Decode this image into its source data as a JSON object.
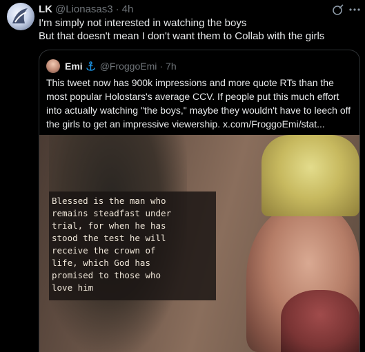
{
  "tweet": {
    "author_name": "LK",
    "handle": "@Lionasas3",
    "separator": "·",
    "time": "4h",
    "lines": [
      "I'm simply not interested in watching the boys",
      "But that doesn't mean I don't want them to Collab with the girls"
    ]
  },
  "quote": {
    "author_name": "Emi",
    "handle": "@FroggoEmi",
    "separator": "·",
    "time": "7h",
    "lines": [
      "This tweet now has 900k impressions and  more quote RTs than the",
      "most popular Holostars's average CCV. If people put this much effort",
      "into actually watching \"the boys,\" maybe they wouldn't have to leech off",
      "the girls to get an impressive viewership.  x.com/FroggoEmi/stat..."
    ]
  },
  "image": {
    "verse_lines": [
      "Blessed is the man who",
      "remains steadfast under",
      "trial, for when he has",
      "stood the test he will",
      "receive the crown of",
      "life, which God has",
      "promised to those who",
      "love him"
    ]
  },
  "icons": {
    "grok": "grok-icon",
    "more": "more-icon",
    "anchor": "anchor-icon"
  },
  "colors": {
    "background": "#000000",
    "text": "#e7e9ea",
    "secondary": "#71767b",
    "border": "#2f3336",
    "anchor_blue": "#1d9bf0"
  }
}
